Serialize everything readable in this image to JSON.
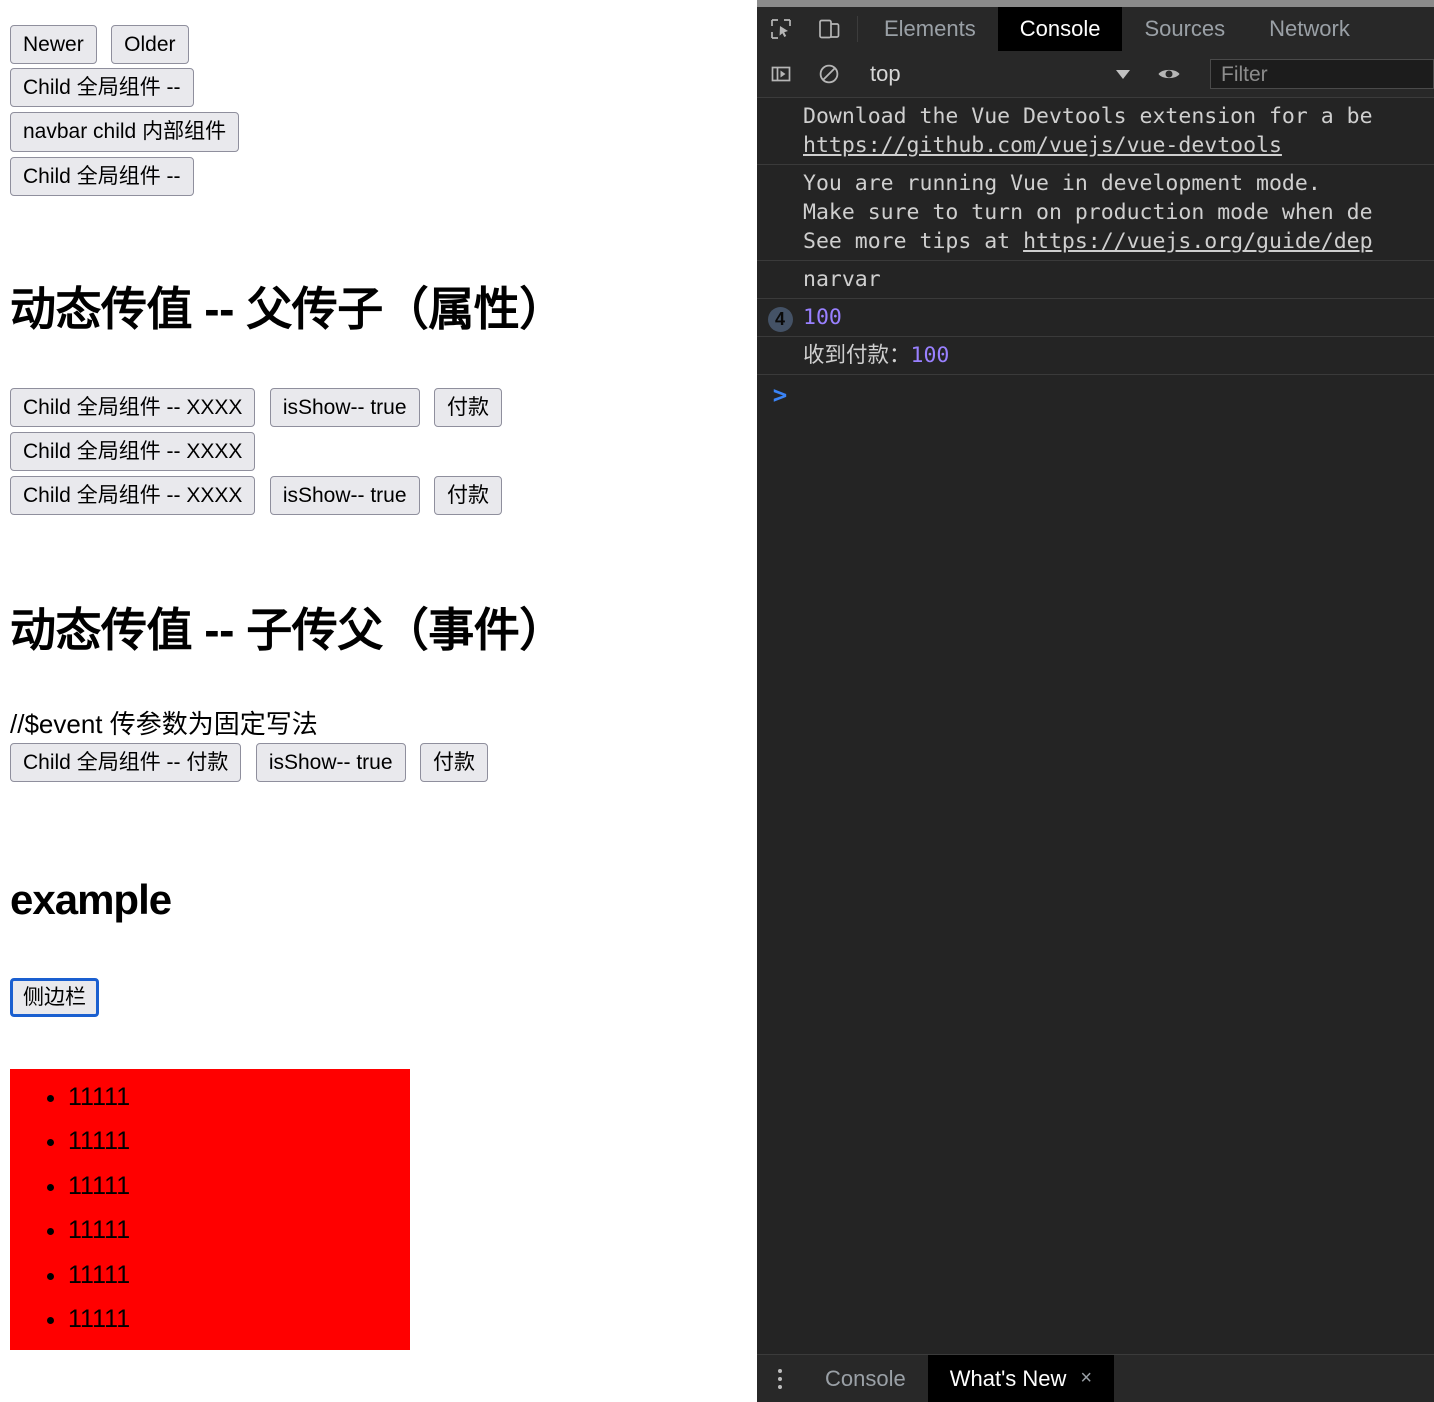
{
  "page": {
    "top_buttons": [
      {
        "label": "Newer"
      },
      {
        "label": "Older"
      }
    ],
    "stack_buttons": [
      {
        "label": "Child 全局组件 --"
      },
      {
        "label": "navbar child 内部组件"
      },
      {
        "label": "Child 全局组件 --"
      }
    ],
    "section_props": {
      "heading": "动态传值 -- 父传子（属性）",
      "rows": [
        {
          "buttons": [
            "Child 全局组件 -- XXXX",
            "isShow-- true",
            "付款"
          ]
        },
        {
          "buttons": [
            "Child 全局组件 -- XXXX"
          ]
        },
        {
          "buttons": [
            "Child 全局组件 -- XXXX",
            "isShow-- true",
            "付款"
          ]
        }
      ]
    },
    "section_events": {
      "heading": "动态传值 -- 子传父（事件）",
      "note": "//$event 传参数为固定写法",
      "rows": [
        {
          "buttons": [
            "Child 全局组件 -- 付款",
            "isShow-- true",
            "付款"
          ]
        }
      ]
    },
    "section_example": {
      "heading": "example",
      "toggle_button": "侧边栏",
      "list_items": [
        "11111",
        "11111",
        "11111",
        "11111",
        "11111",
        "11111"
      ],
      "list_bg_color": "#ff0000"
    }
  },
  "devtools": {
    "tabs": [
      {
        "label": "Elements",
        "active": false
      },
      {
        "label": "Console",
        "active": true
      },
      {
        "label": "Sources",
        "active": false
      },
      {
        "label": "Network",
        "active": false
      }
    ],
    "toolbar": {
      "context": "top",
      "filter_placeholder": "Filter"
    },
    "console_messages": [
      {
        "id": "vue-devtools",
        "count": "",
        "lines": [
          [
            {
              "t": "Download the Vue Devtools extension for a be",
              "k": "plain"
            }
          ],
          [
            {
              "t": "https://github.com/vuejs/vue-devtools",
              "k": "link"
            }
          ]
        ]
      },
      {
        "id": "vue-dev-mode",
        "count": "",
        "lines": [
          [
            {
              "t": "You are running Vue in development mode.",
              "k": "plain"
            }
          ],
          [
            {
              "t": "Make sure to turn on production mode when de",
              "k": "plain"
            }
          ],
          [
            {
              "t": "See more tips at ",
              "k": "plain"
            },
            {
              "t": "https://vuejs.org/guide/dep",
              "k": "link"
            }
          ]
        ]
      },
      {
        "id": "narvar",
        "count": "",
        "lines": [
          [
            {
              "t": "narvar",
              "k": "plain"
            }
          ]
        ]
      },
      {
        "id": "hundred",
        "count": "4",
        "lines": [
          [
            {
              "t": "100",
              "k": "num"
            }
          ]
        ]
      },
      {
        "id": "payment-received",
        "count": "",
        "lines": [
          [
            {
              "t": "收到付款：",
              "k": "cn"
            },
            {
              "t": "100",
              "k": "num"
            }
          ]
        ]
      }
    ],
    "prompt": ">",
    "drawer": {
      "tabs": [
        {
          "label": "Console",
          "active": false,
          "closable": false
        },
        {
          "label": "What's New",
          "active": true,
          "closable": true
        }
      ],
      "close_glyph": "×"
    },
    "colors": {
      "panel_bg": "#242424",
      "toolbar_bg": "#282828",
      "active_tab_bg": "#000000",
      "text": "#cfcfcf",
      "number": "#9980ff",
      "link": "#cfcfcf",
      "prompt": "#3a83f5",
      "badge_bg": "#445266"
    }
  }
}
